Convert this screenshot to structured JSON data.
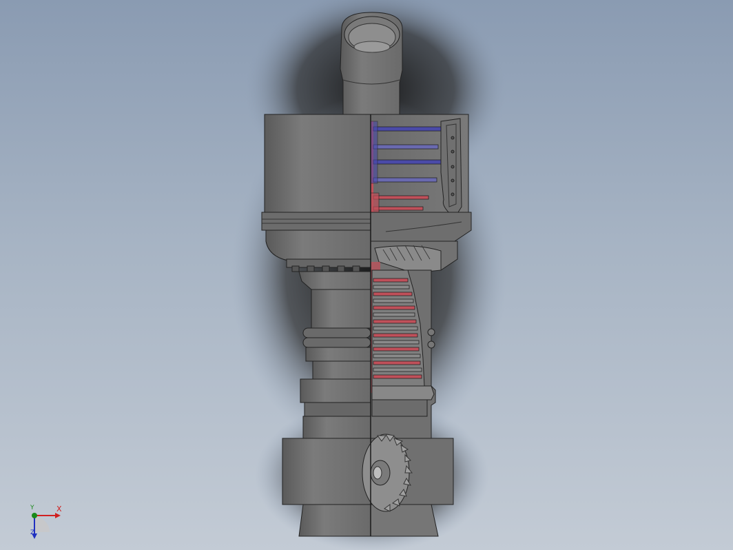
{
  "viewport": {
    "name": "3d-graphics-area"
  },
  "model": {
    "description_icon": "turbine-section-view",
    "colors": {
      "body": "#6f6f6f",
      "body_light": "#8a8a8a",
      "body_dark": "#454545",
      "section_red": "#c0505a",
      "section_blue": "#4a4aa8",
      "shadow": "#1a1a1a"
    }
  },
  "triad": {
    "x": "X",
    "y": "Y",
    "z": "Z",
    "colors": {
      "x": "#d02020",
      "y": "#1a8a1a",
      "z": "#2030c0"
    }
  }
}
